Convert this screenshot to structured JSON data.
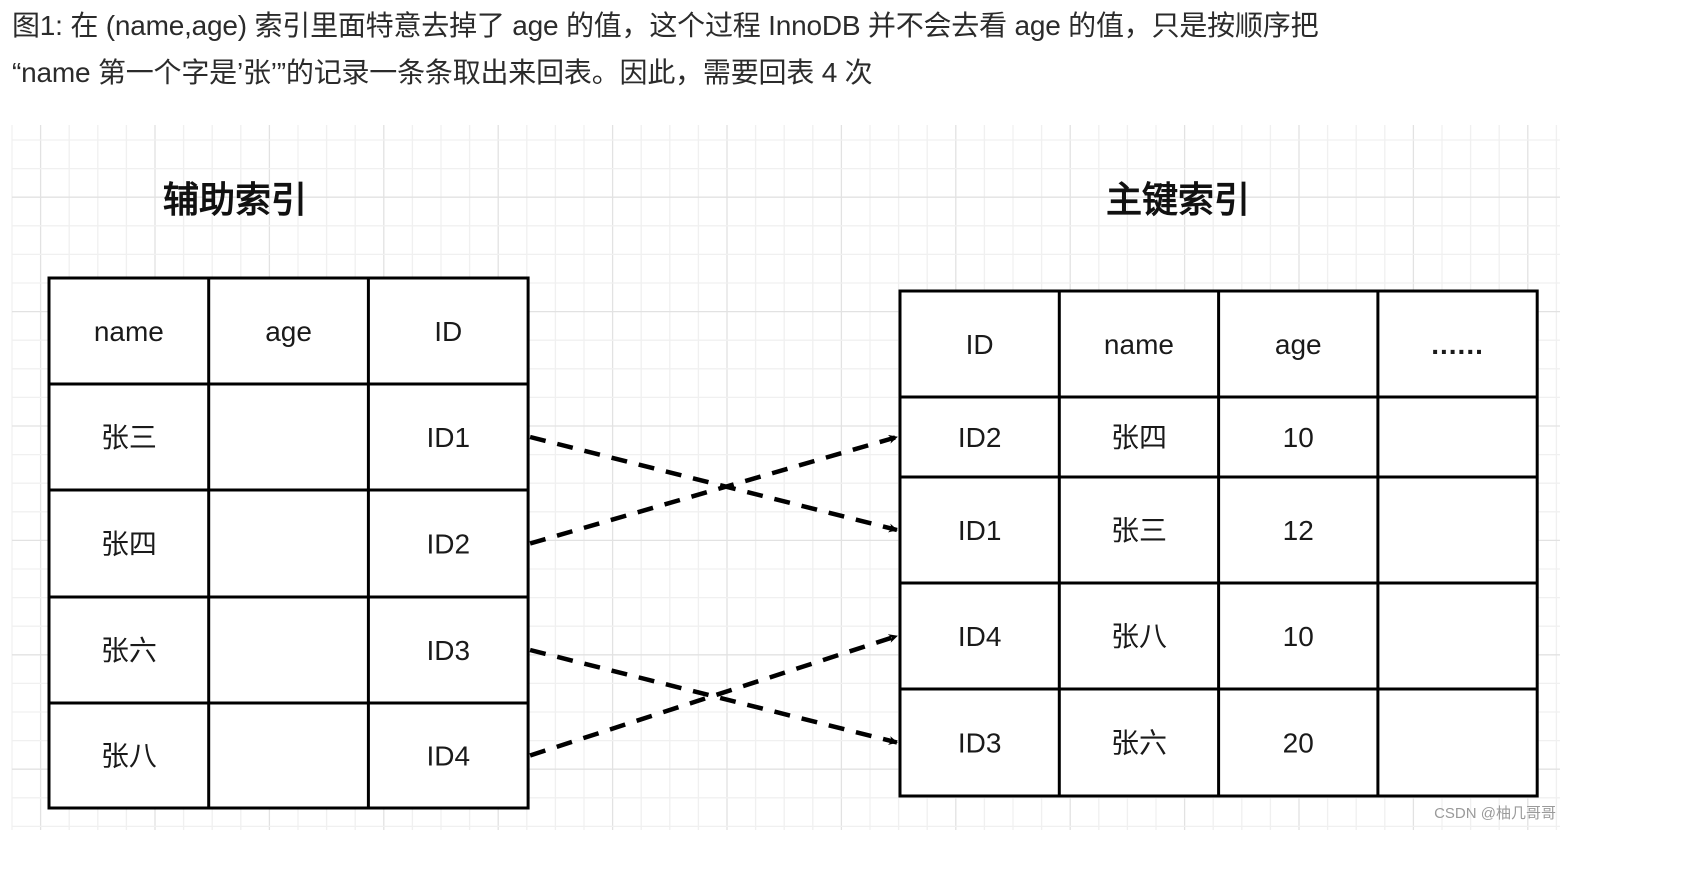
{
  "caption": {
    "line1": "图1: 在 (name,age) 索引里面特意去掉了 age 的值，这个过程 InnoDB 并不会去看 age 的值，只是按顺序把",
    "line2": "“name 第一个字是’张’”的记录一条条取出来回表。因此，需要回表 4 次"
  },
  "secondary_index": {
    "title": "辅助索引",
    "headers": [
      "name",
      "age",
      "ID"
    ],
    "rows": [
      [
        "张三",
        "",
        "ID1"
      ],
      [
        "张四",
        "",
        "ID2"
      ],
      [
        "张六",
        "",
        "ID3"
      ],
      [
        "张八",
        "",
        "ID4"
      ]
    ]
  },
  "primary_index": {
    "title": "主键索引",
    "headers": [
      "ID",
      "name",
      "age",
      "......"
    ],
    "rows": [
      [
        "ID2",
        "张四",
        "10",
        ""
      ],
      [
        "ID1",
        "张三",
        "12",
        ""
      ],
      [
        "ID4",
        "张八",
        "10",
        ""
      ],
      [
        "ID3",
        "张六",
        "20",
        ""
      ]
    ]
  },
  "lookups": [
    {
      "from": "ID1",
      "to": "ID1"
    },
    {
      "from": "ID2",
      "to": "ID2"
    },
    {
      "from": "ID3",
      "to": "ID3"
    },
    {
      "from": "ID4",
      "to": "ID4"
    }
  ],
  "edge_style": "dashed-arrow",
  "watermark": "CSDN @柚几哥哥",
  "colors": {
    "text": "#2b2b2b",
    "line": "#000000",
    "grid_minor": "#f0f0f0",
    "grid_major": "#e2e2e2",
    "watermark": "#9a9a9a"
  }
}
